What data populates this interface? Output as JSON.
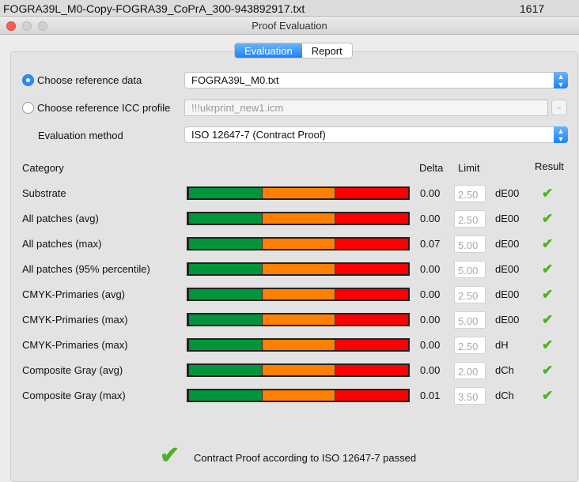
{
  "file_bar": {
    "filename": "FOGRA39L_M0-Copy-FOGRA39_CoPrA_300-943892917.txt",
    "number": "1617"
  },
  "window": {
    "title": "Proof Evaluation"
  },
  "tabs": [
    {
      "label": "Evaluation",
      "active": true
    },
    {
      "label": "Report",
      "active": false
    }
  ],
  "reference": {
    "data_label": "Choose reference data",
    "data_value": "FOGRA39L_M0.txt",
    "data_selected": true,
    "icc_label": "Choose reference ICC profile",
    "icc_value": "!!!ukrprint_new1.icm",
    "method_label": "Evaluation method",
    "method_value": "ISO 12647-7 (Contract Proof)"
  },
  "table": {
    "headers": {
      "category": "Category",
      "delta": "Delta",
      "limit": "Limit",
      "result": "Result"
    },
    "rows": [
      {
        "category": "Substrate",
        "delta": "0.00",
        "limit": "2.50",
        "unit": "dE00",
        "passed": true
      },
      {
        "category": "All patches (avg)",
        "delta": "0.00",
        "limit": "2.50",
        "unit": "dE00",
        "passed": true
      },
      {
        "category": "All patches (max)",
        "delta": "0.07",
        "limit": "5.00",
        "unit": "dE00",
        "passed": true
      },
      {
        "category": "All patches (95% percentile)",
        "delta": "0.00",
        "limit": "5.00",
        "unit": "dE00",
        "passed": true
      },
      {
        "category": "CMYK-Primaries (avg)",
        "delta": "0.00",
        "limit": "2.50",
        "unit": "dE00",
        "passed": true
      },
      {
        "category": "CMYK-Primaries (max)",
        "delta": "0.00",
        "limit": "5.00",
        "unit": "dE00",
        "passed": true
      },
      {
        "category": "CMYK-Primaries (max)",
        "delta": "0.00",
        "limit": "2.50",
        "unit": "dH",
        "passed": true
      },
      {
        "category": "Composite Gray (avg)",
        "delta": "0.00",
        "limit": "2.00",
        "unit": "dCh",
        "passed": true
      },
      {
        "category": "Composite Gray (max)",
        "delta": "0.01",
        "limit": "3.50",
        "unit": "dCh",
        "passed": true
      }
    ]
  },
  "colors": {
    "green": "#00943c",
    "orange": "#ff8000",
    "red": "#ff0000",
    "accent": "#1a82fb",
    "check": "#4bb320"
  },
  "summary": {
    "text": "Contract Proof according to ISO 12647-7 passed"
  }
}
